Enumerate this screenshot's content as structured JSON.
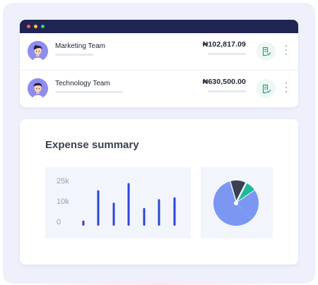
{
  "window": {
    "controls": [
      "close",
      "minimize",
      "maximize"
    ],
    "colors": {
      "titlebar": "#1f2452",
      "close": "#ff5a5f",
      "minimize": "#ffc542",
      "maximize": "#3ad17a"
    }
  },
  "teams": [
    {
      "name": "Marketing Team",
      "amount": "₦102,817.09",
      "icon": "document-check-icon"
    },
    {
      "name": "Technology Team",
      "amount": "₦630,500.00",
      "icon": "document-check-icon"
    }
  ],
  "summary": {
    "title": "Expense summary"
  },
  "chart_data": [
    {
      "type": "bar",
      "title": "",
      "xlabel": "",
      "ylabel": "",
      "y_ticks": [
        "25k",
        "10k",
        "0"
      ],
      "ylim": [
        0,
        25000
      ],
      "values": [
        3000,
        20000,
        13000,
        24000,
        10000,
        15000,
        16000
      ],
      "color": "#2c46d6",
      "grid": false
    },
    {
      "type": "pie",
      "slices": [
        {
          "value": 58,
          "color": "#7b97f2",
          "exploded": false
        },
        {
          "value": 12,
          "color": "#3a4054",
          "exploded": true
        },
        {
          "value": 8,
          "color": "#1fb89b",
          "exploded": true
        },
        {
          "value": 22,
          "color": "#7b97f2",
          "exploded": false
        }
      ]
    }
  ]
}
